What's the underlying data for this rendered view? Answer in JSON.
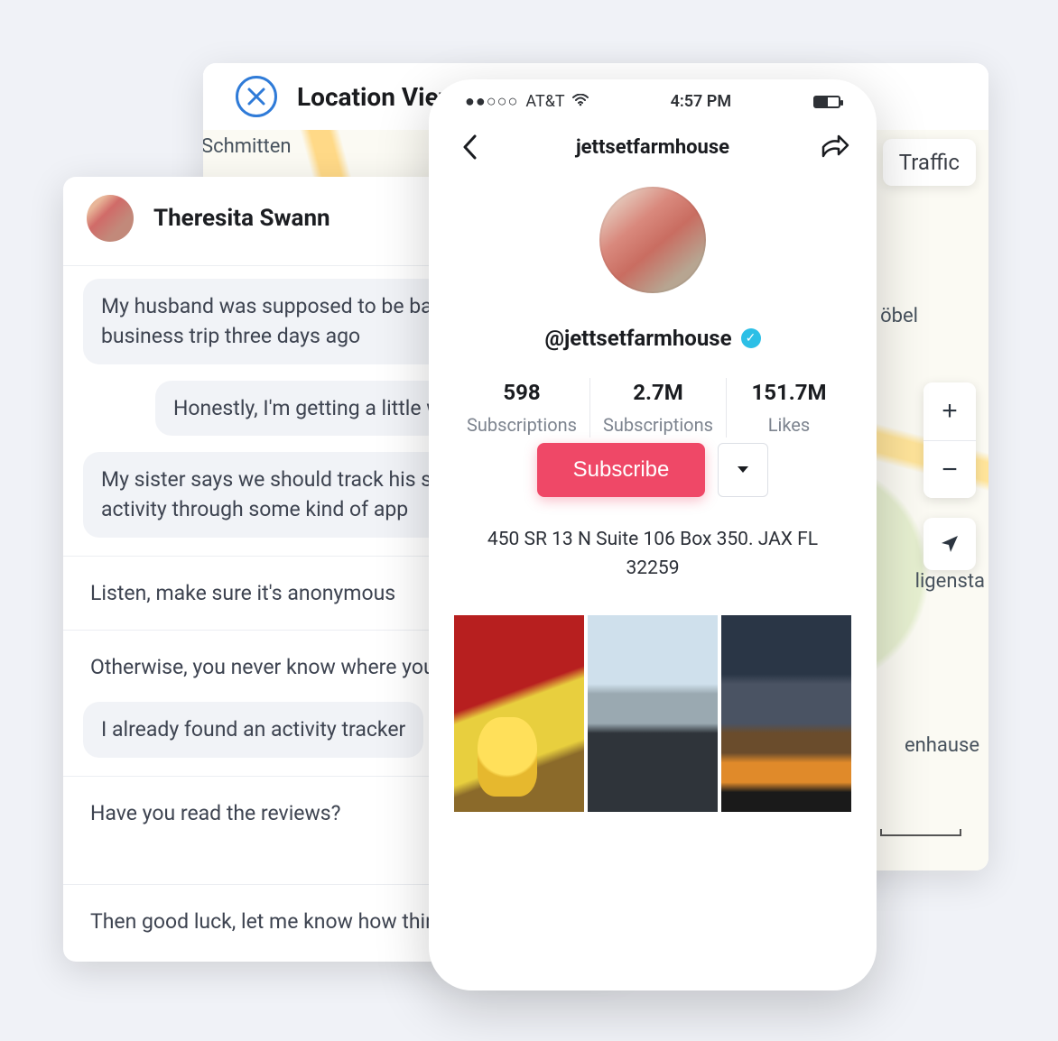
{
  "map": {
    "title": "Location Viewer",
    "traffic_label": "Traffic",
    "labels": {
      "schmitten": "Schmitten",
      "obel": "öbel",
      "ligensta": "ligensta",
      "enhause": "enhause"
    },
    "scale": "m"
  },
  "chat": {
    "name": "Theresita Swann",
    "messages": {
      "m1": "My husband was supposed to be back from a business trip three days ago",
      "m2": "Honestly, I'm getting a little worried",
      "m3": "My sister says we should track his social media activity through some kind of app",
      "m4": "Listen, make sure it's anonymous",
      "m5": "Otherwise, you never know where you'll have to go.",
      "m6": "I already found an activity tracker",
      "m7": "Have you read the reviews?",
      "m8": "Then good luck, let me know how things turn out."
    }
  },
  "phone": {
    "status": {
      "carrier": "AT&T",
      "time": "4:57 PM"
    },
    "title": "jettsetfarmhouse",
    "handle": "@jettsetfarmhouse",
    "stats": {
      "v1": "598",
      "l1": "Subscriptions",
      "v2": "2.7M",
      "l2": "Subscriptions",
      "v3": "151.7M",
      "l3": "Likes"
    },
    "subscribe_label": "Subscribe",
    "bio": "450 SR 13 N Suite 106 Box 350. JAX FL 32259"
  }
}
